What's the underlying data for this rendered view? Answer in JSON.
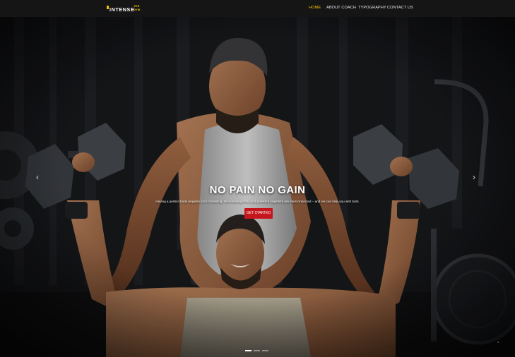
{
  "brand": {
    "name": "INTENSE",
    "badge_line1": "FEE",
    "badge_line2": "GYM",
    "accent_color": "#f2c200"
  },
  "nav": {
    "items": [
      {
        "label": "HOME",
        "active": true
      },
      {
        "label": "ABOUT COACH",
        "active": false
      },
      {
        "label": "TYPOGRAPHY",
        "active": false
      },
      {
        "label": "CONTACT US",
        "active": false
      }
    ]
  },
  "hero": {
    "headline": "NO PAIN NO GAIN",
    "subtext": "Having a perfect body requires a lot of training. Nice-looking body and powerful organism are interconnected – and we can help you with both.",
    "cta_label": "GET STARTED",
    "cta_color": "#c4161c",
    "prev_icon": "chevron-left-icon",
    "next_icon": "chevron-right-icon",
    "slide_count": 3,
    "active_slide": 1
  },
  "back_to_top_icon": "chevron-up-icon"
}
